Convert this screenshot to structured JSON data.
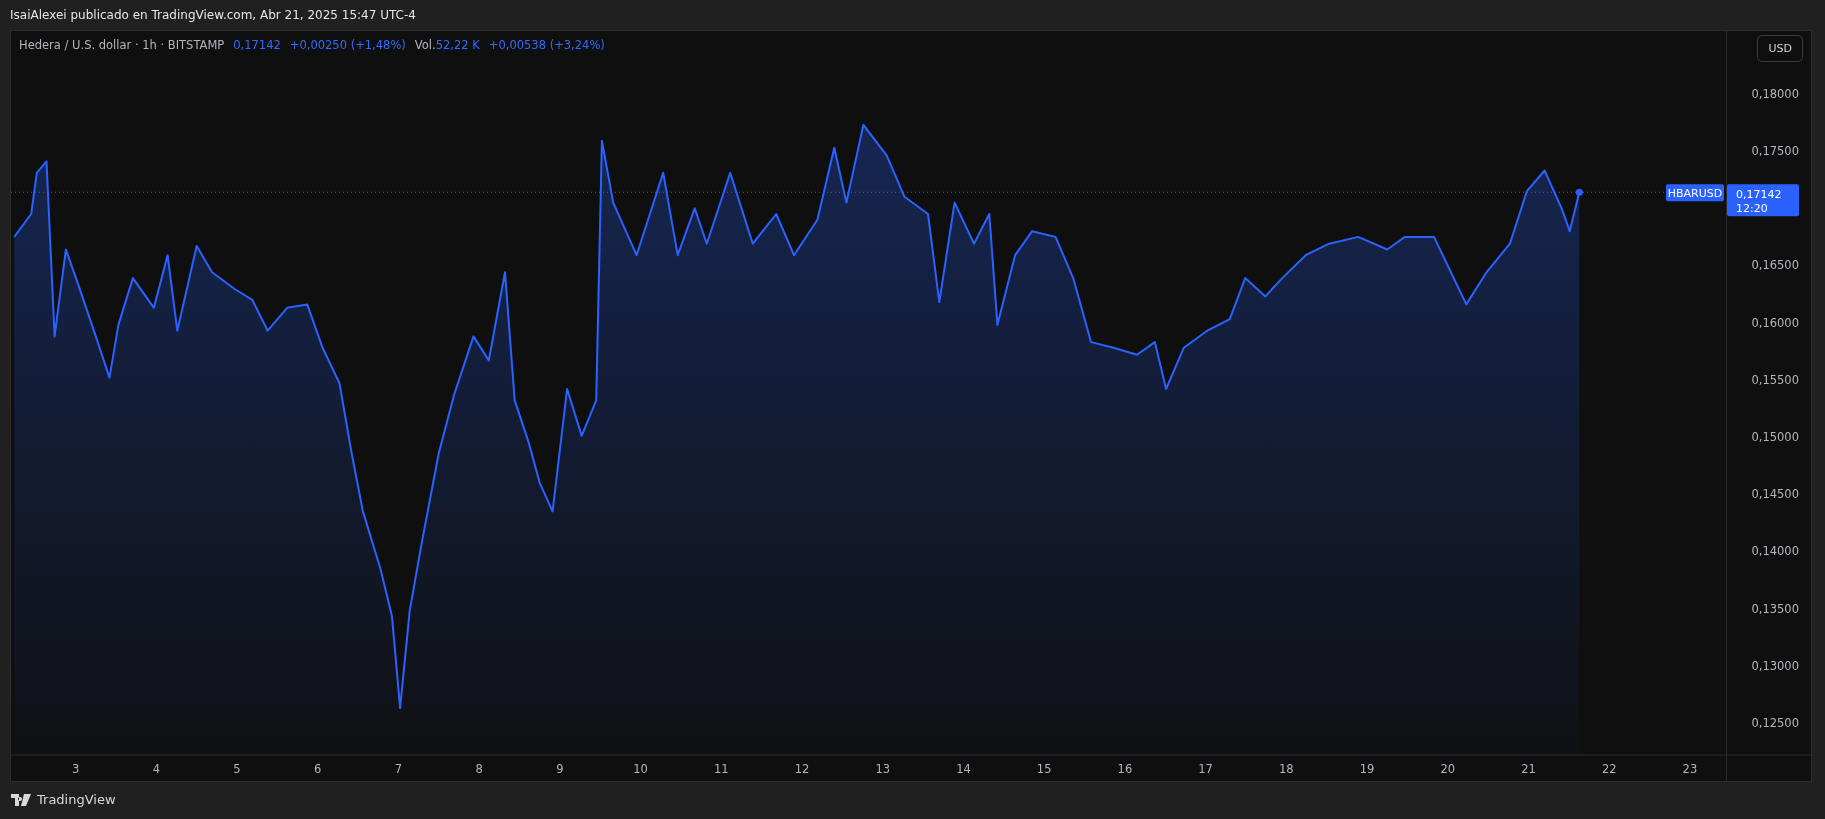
{
  "header": {
    "text": "IsaiAlexei publicado en TradingView.com, Abr 21, 2025 15:47 UTC-4"
  },
  "legend": {
    "symbol": "Hedera / U.S. dollar · 1h · BITSTAMP",
    "price": "0,17142",
    "change": "+0,00250 (+1,48%)",
    "volume_label": "Vol.",
    "volume": "52,22 K",
    "volume_change": "+0,00538 (+3,24%)"
  },
  "currency_button": "USD",
  "chart_data": {
    "type": "area",
    "x": [
      2.24,
      2.45,
      2.52,
      2.64,
      2.74,
      2.88,
      3.03,
      3.25,
      3.42,
      3.53,
      3.71,
      3.97,
      4.14,
      4.26,
      4.5,
      4.69,
      4.98,
      5.19,
      5.38,
      5.62,
      5.87,
      6.06,
      6.27,
      6.42,
      6.56,
      6.78,
      6.92,
      7.02,
      7.14,
      7.28,
      7.5,
      7.69,
      7.93,
      8.12,
      8.32,
      8.44,
      8.61,
      8.75,
      8.91,
      9.09,
      9.27,
      9.45,
      9.52,
      9.66,
      9.95,
      10.28,
      10.46,
      10.67,
      10.82,
      11.11,
      11.39,
      11.68,
      11.9,
      12.19,
      12.4,
      12.55,
      12.76,
      13.05,
      13.27,
      13.56,
      13.7,
      13.89,
      14.13,
      14.32,
      14.42,
      14.64,
      14.85,
      15.14,
      15.36,
      15.58,
      15.86,
      16.15,
      16.37,
      16.51,
      16.73,
      17.02,
      17.3,
      17.49,
      17.74,
      17.95,
      18.24,
      18.53,
      18.89,
      19.25,
      19.47,
      19.83,
      20.23,
      20.48,
      20.77,
      20.98,
      21.2,
      21.41,
      21.51,
      21.63
    ],
    "series": [
      {
        "name": "HBARUSD",
        "color": "#2962ff",
        "values": [
          0.1675,
          0.1695,
          0.1731,
          0.1741,
          0.1588,
          0.1664,
          0.1634,
          0.1588,
          0.1552,
          0.1598,
          0.1639,
          0.1613,
          0.1659,
          0.1593,
          0.1667,
          0.1644,
          0.1629,
          0.162,
          0.1593,
          0.1613,
          0.1616,
          0.1578,
          0.1547,
          0.1486,
          0.1435,
          0.1384,
          0.1343,
          0.1263,
          0.1348,
          0.1404,
          0.1486,
          0.1537,
          0.1588,
          0.1567,
          0.1644,
          0.1532,
          0.1496,
          0.146,
          0.1435,
          0.1542,
          0.1501,
          0.1532,
          0.1759,
          0.1705,
          0.1659,
          0.1731,
          0.1659,
          0.17,
          0.1669,
          0.1731,
          0.1669,
          0.1695,
          0.1659,
          0.169,
          0.1753,
          0.1705,
          0.1773,
          0.1746,
          0.171,
          0.1695,
          0.1618,
          0.1705,
          0.1669,
          0.1695,
          0.1598,
          0.1659,
          0.168,
          0.1675,
          0.1639,
          0.1583,
          0.1578,
          0.1572,
          0.1583,
          0.1542,
          0.1578,
          0.1593,
          0.1603,
          0.1639,
          0.1623,
          0.1639,
          0.1659,
          0.1669,
          0.1675,
          0.1664,
          0.1675,
          0.1675,
          0.1616,
          0.1644,
          0.1669,
          0.1715,
          0.1733,
          0.17,
          0.168,
          0.1714
        ]
      }
    ],
    "xlim": [
      2.2,
      24.5
    ],
    "ylim": [
      0.1222,
      0.1855
    ],
    "xticks": [
      3,
      4,
      5,
      6,
      7,
      8,
      9,
      10,
      11,
      12,
      13,
      14,
      15,
      16,
      17,
      18,
      19,
      20,
      21,
      22,
      23
    ],
    "yticks": [
      {
        "value": 0.18,
        "label": "0,18000"
      },
      {
        "value": 0.175,
        "label": "0,17500"
      },
      {
        "value": 0.165,
        "label": "0,16500"
      },
      {
        "value": 0.16,
        "label": "0,16000"
      },
      {
        "value": 0.155,
        "label": "0,15500"
      },
      {
        "value": 0.15,
        "label": "0,15000"
      },
      {
        "value": 0.145,
        "label": "0,14500"
      },
      {
        "value": 0.14,
        "label": "0,14000"
      },
      {
        "value": 0.135,
        "label": "0,13500"
      },
      {
        "value": 0.13,
        "label": "0,13000"
      },
      {
        "value": 0.125,
        "label": "0,12500"
      }
    ]
  },
  "last_price": {
    "price": "0,17142",
    "countdown": "12:20"
  },
  "footer": {
    "brand": "TradingView"
  }
}
